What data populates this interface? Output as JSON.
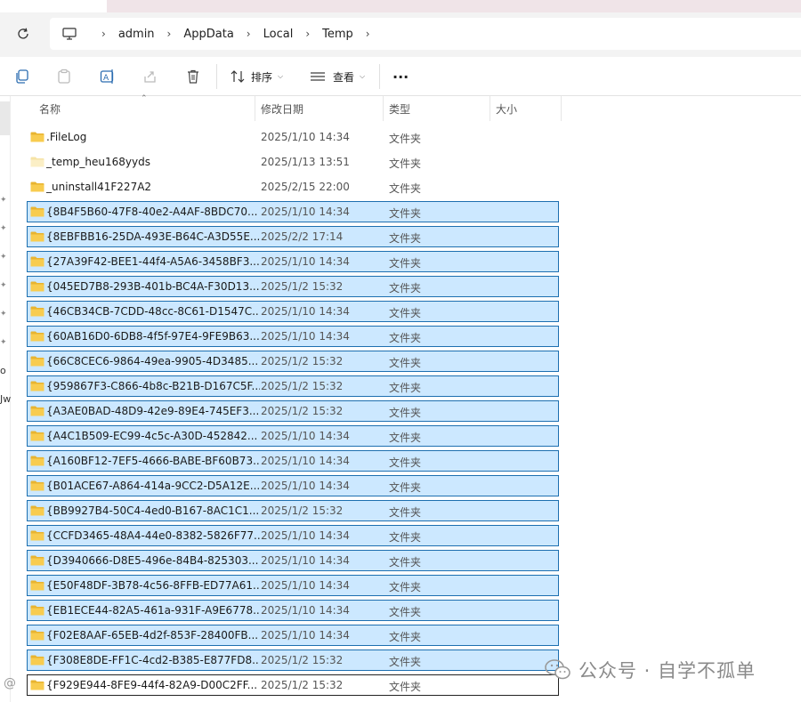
{
  "address": {
    "crumbs": [
      "admin",
      "AppData",
      "Local",
      "Temp"
    ]
  },
  "toolbar": {
    "sort_label": "排序",
    "view_label": "查看",
    "more_label": "···"
  },
  "columns": {
    "name": "名称",
    "date": "修改日期",
    "type": "类型",
    "size": "大小"
  },
  "nav": {
    "text_a": "o",
    "text_b": "Jw"
  },
  "files": [
    {
      "name": ".FileLog",
      "date": "2025/1/10 14:34",
      "type": "文件夹"
    },
    {
      "name": "_temp_heu168yyds",
      "date": "2025/1/13 13:51",
      "type": "文件夹"
    },
    {
      "name": "_uninstall41F227A2",
      "date": "2025/2/15 22:00",
      "type": "文件夹"
    },
    {
      "name": "{8B4F5B60-47F8-40e2-A4AF-8BDC70...",
      "date": "2025/1/10 14:34",
      "type": "文件夹"
    },
    {
      "name": "{8EBFBB16-25DA-493E-B64C-A3D55E...",
      "date": "2025/2/2 17:14",
      "type": "文件夹"
    },
    {
      "name": "{27A39F42-BEE1-44f4-A5A6-3458BF3...",
      "date": "2025/1/10 14:34",
      "type": "文件夹"
    },
    {
      "name": "{045ED7B8-293B-401b-BC4A-F30D13...",
      "date": "2025/1/2 15:32",
      "type": "文件夹"
    },
    {
      "name": "{46CB34CB-7CDD-48cc-8C61-D1547C...",
      "date": "2025/1/10 14:34",
      "type": "文件夹"
    },
    {
      "name": "{60AB16D0-6DB8-4f5f-97E4-9FE9B63...",
      "date": "2025/1/10 14:34",
      "type": "文件夹"
    },
    {
      "name": "{66C8CEC6-9864-49ea-9905-4D3485...",
      "date": "2025/1/2 15:32",
      "type": "文件夹"
    },
    {
      "name": "{959867F3-C866-4b8c-B21B-D167C5F...",
      "date": "2025/1/2 15:32",
      "type": "文件夹"
    },
    {
      "name": "{A3AE0BAD-48D9-42e9-89E4-745EF3...",
      "date": "2025/1/2 15:32",
      "type": "文件夹"
    },
    {
      "name": "{A4C1B509-EC99-4c5c-A30D-452842...",
      "date": "2025/1/10 14:34",
      "type": "文件夹"
    },
    {
      "name": "{A160BF12-7EF5-4666-BABE-BF60B73...",
      "date": "2025/1/10 14:34",
      "type": "文件夹"
    },
    {
      "name": "{B01ACE67-A864-414a-9CC2-D5A12E...",
      "date": "2025/1/10 14:34",
      "type": "文件夹"
    },
    {
      "name": "{BB9927B4-50C4-4ed0-B167-8AC1C1...",
      "date": "2025/1/2 15:32",
      "type": "文件夹"
    },
    {
      "name": "{CCFD3465-48A4-44e0-8382-5826F77...",
      "date": "2025/1/10 14:34",
      "type": "文件夹"
    },
    {
      "name": "{D3940666-D8E5-496e-84B4-825303...",
      "date": "2025/1/10 14:34",
      "type": "文件夹"
    },
    {
      "name": "{E50F48DF-3B78-4c56-8FFB-ED77A61...",
      "date": "2025/1/10 14:34",
      "type": "文件夹"
    },
    {
      "name": "{EB1ECE44-82A5-461a-931F-A9E6778...",
      "date": "2025/1/10 14:34",
      "type": "文件夹"
    },
    {
      "name": "{F02E8AAF-65EB-4d2f-853F-28400FB...",
      "date": "2025/1/10 14:34",
      "type": "文件夹"
    },
    {
      "name": "{F308E8DE-FF1C-4cd2-B385-E877FD8...",
      "date": "2025/1/2 15:32",
      "type": "文件夹"
    },
    {
      "name": "{F929E944-8FE9-44f4-82A9-D00C2FF...",
      "date": "2025/1/2 15:32",
      "type": "文件夹"
    }
  ],
  "watermark": {
    "text": "公众号 · 自学不孤单",
    "corner": "@"
  }
}
